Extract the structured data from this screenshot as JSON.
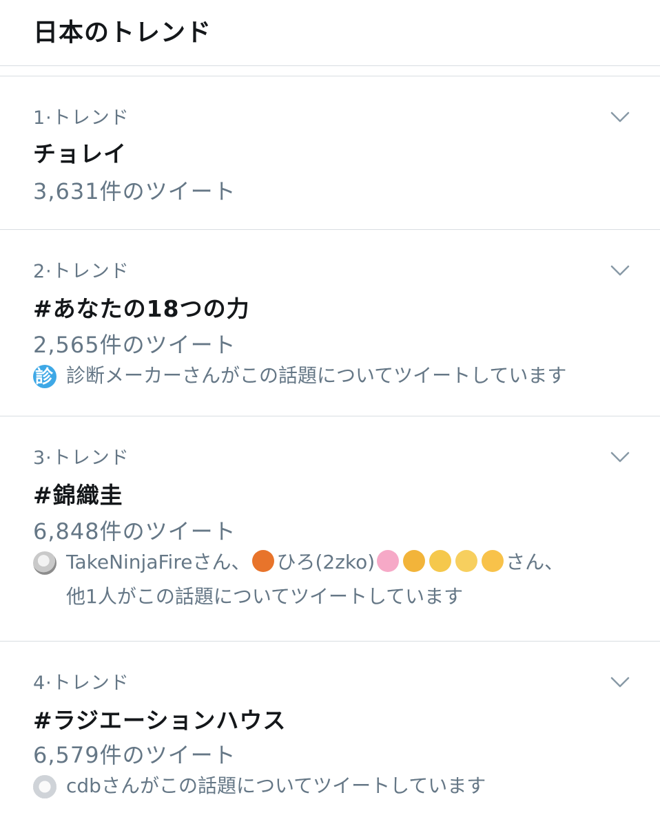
{
  "header": {
    "title": "日本のトレンド"
  },
  "trends": [
    {
      "rank": "1·トレンド",
      "name": "チョレイ",
      "count": "3,631件のツイート"
    },
    {
      "rank": "2·トレンド",
      "name": "#あなたの18つの力",
      "count": "2,565件のツイート",
      "context": "診断メーカーさんがこの話題についてツイートしています",
      "avatar_glyph": "診"
    },
    {
      "rank": "3·トレンド",
      "name": "#錦織圭",
      "count": "6,848件のツイート",
      "context_user1": "TakeNinjaFireさん、",
      "context_user2": "ひろ(2zko)",
      "context_suffix": "さん、",
      "context_line2": "他1人がこの話題についてツイートしています",
      "emojis": [
        "fox-emoji",
        "cherry-blossom-emoji",
        "tiger-emoji",
        "princess-emoji",
        "angel-emoji",
        "baby-emoji"
      ]
    },
    {
      "rank": "4·トレンド",
      "name": "#ラジエーションハウス",
      "count": "6,579件のツイート",
      "context": "cdbさんがこの話題についてツイートしています"
    }
  ],
  "colors": {
    "text_primary": "#14171a",
    "text_secondary": "#657786",
    "divider": "#d8dde1",
    "shindan_badge": "#3ea8e6"
  }
}
